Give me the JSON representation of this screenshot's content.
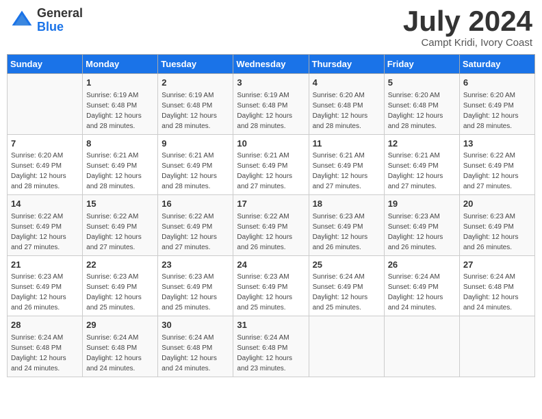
{
  "header": {
    "logo_general": "General",
    "logo_blue": "Blue",
    "month_title": "July 2024",
    "location": "Campt Kridi, Ivory Coast"
  },
  "days_of_week": [
    "Sunday",
    "Monday",
    "Tuesday",
    "Wednesday",
    "Thursday",
    "Friday",
    "Saturday"
  ],
  "weeks": [
    [
      {
        "day": "",
        "info": ""
      },
      {
        "day": "1",
        "info": "Sunrise: 6:19 AM\nSunset: 6:48 PM\nDaylight: 12 hours\nand 28 minutes."
      },
      {
        "day": "2",
        "info": "Sunrise: 6:19 AM\nSunset: 6:48 PM\nDaylight: 12 hours\nand 28 minutes."
      },
      {
        "day": "3",
        "info": "Sunrise: 6:19 AM\nSunset: 6:48 PM\nDaylight: 12 hours\nand 28 minutes."
      },
      {
        "day": "4",
        "info": "Sunrise: 6:20 AM\nSunset: 6:48 PM\nDaylight: 12 hours\nand 28 minutes."
      },
      {
        "day": "5",
        "info": "Sunrise: 6:20 AM\nSunset: 6:48 PM\nDaylight: 12 hours\nand 28 minutes."
      },
      {
        "day": "6",
        "info": "Sunrise: 6:20 AM\nSunset: 6:49 PM\nDaylight: 12 hours\nand 28 minutes."
      }
    ],
    [
      {
        "day": "7",
        "info": "Sunrise: 6:20 AM\nSunset: 6:49 PM\nDaylight: 12 hours\nand 28 minutes."
      },
      {
        "day": "8",
        "info": "Sunrise: 6:21 AM\nSunset: 6:49 PM\nDaylight: 12 hours\nand 28 minutes."
      },
      {
        "day": "9",
        "info": "Sunrise: 6:21 AM\nSunset: 6:49 PM\nDaylight: 12 hours\nand 28 minutes."
      },
      {
        "day": "10",
        "info": "Sunrise: 6:21 AM\nSunset: 6:49 PM\nDaylight: 12 hours\nand 27 minutes."
      },
      {
        "day": "11",
        "info": "Sunrise: 6:21 AM\nSunset: 6:49 PM\nDaylight: 12 hours\nand 27 minutes."
      },
      {
        "day": "12",
        "info": "Sunrise: 6:21 AM\nSunset: 6:49 PM\nDaylight: 12 hours\nand 27 minutes."
      },
      {
        "day": "13",
        "info": "Sunrise: 6:22 AM\nSunset: 6:49 PM\nDaylight: 12 hours\nand 27 minutes."
      }
    ],
    [
      {
        "day": "14",
        "info": "Sunrise: 6:22 AM\nSunset: 6:49 PM\nDaylight: 12 hours\nand 27 minutes."
      },
      {
        "day": "15",
        "info": "Sunrise: 6:22 AM\nSunset: 6:49 PM\nDaylight: 12 hours\nand 27 minutes."
      },
      {
        "day": "16",
        "info": "Sunrise: 6:22 AM\nSunset: 6:49 PM\nDaylight: 12 hours\nand 27 minutes."
      },
      {
        "day": "17",
        "info": "Sunrise: 6:22 AM\nSunset: 6:49 PM\nDaylight: 12 hours\nand 26 minutes."
      },
      {
        "day": "18",
        "info": "Sunrise: 6:23 AM\nSunset: 6:49 PM\nDaylight: 12 hours\nand 26 minutes."
      },
      {
        "day": "19",
        "info": "Sunrise: 6:23 AM\nSunset: 6:49 PM\nDaylight: 12 hours\nand 26 minutes."
      },
      {
        "day": "20",
        "info": "Sunrise: 6:23 AM\nSunset: 6:49 PM\nDaylight: 12 hours\nand 26 minutes."
      }
    ],
    [
      {
        "day": "21",
        "info": "Sunrise: 6:23 AM\nSunset: 6:49 PM\nDaylight: 12 hours\nand 26 minutes."
      },
      {
        "day": "22",
        "info": "Sunrise: 6:23 AM\nSunset: 6:49 PM\nDaylight: 12 hours\nand 25 minutes."
      },
      {
        "day": "23",
        "info": "Sunrise: 6:23 AM\nSunset: 6:49 PM\nDaylight: 12 hours\nand 25 minutes."
      },
      {
        "day": "24",
        "info": "Sunrise: 6:23 AM\nSunset: 6:49 PM\nDaylight: 12 hours\nand 25 minutes."
      },
      {
        "day": "25",
        "info": "Sunrise: 6:24 AM\nSunset: 6:49 PM\nDaylight: 12 hours\nand 25 minutes."
      },
      {
        "day": "26",
        "info": "Sunrise: 6:24 AM\nSunset: 6:49 PM\nDaylight: 12 hours\nand 24 minutes."
      },
      {
        "day": "27",
        "info": "Sunrise: 6:24 AM\nSunset: 6:48 PM\nDaylight: 12 hours\nand 24 minutes."
      }
    ],
    [
      {
        "day": "28",
        "info": "Sunrise: 6:24 AM\nSunset: 6:48 PM\nDaylight: 12 hours\nand 24 minutes."
      },
      {
        "day": "29",
        "info": "Sunrise: 6:24 AM\nSunset: 6:48 PM\nDaylight: 12 hours\nand 24 minutes."
      },
      {
        "day": "30",
        "info": "Sunrise: 6:24 AM\nSunset: 6:48 PM\nDaylight: 12 hours\nand 24 minutes."
      },
      {
        "day": "31",
        "info": "Sunrise: 6:24 AM\nSunset: 6:48 PM\nDaylight: 12 hours\nand 23 minutes."
      },
      {
        "day": "",
        "info": ""
      },
      {
        "day": "",
        "info": ""
      },
      {
        "day": "",
        "info": ""
      }
    ]
  ]
}
